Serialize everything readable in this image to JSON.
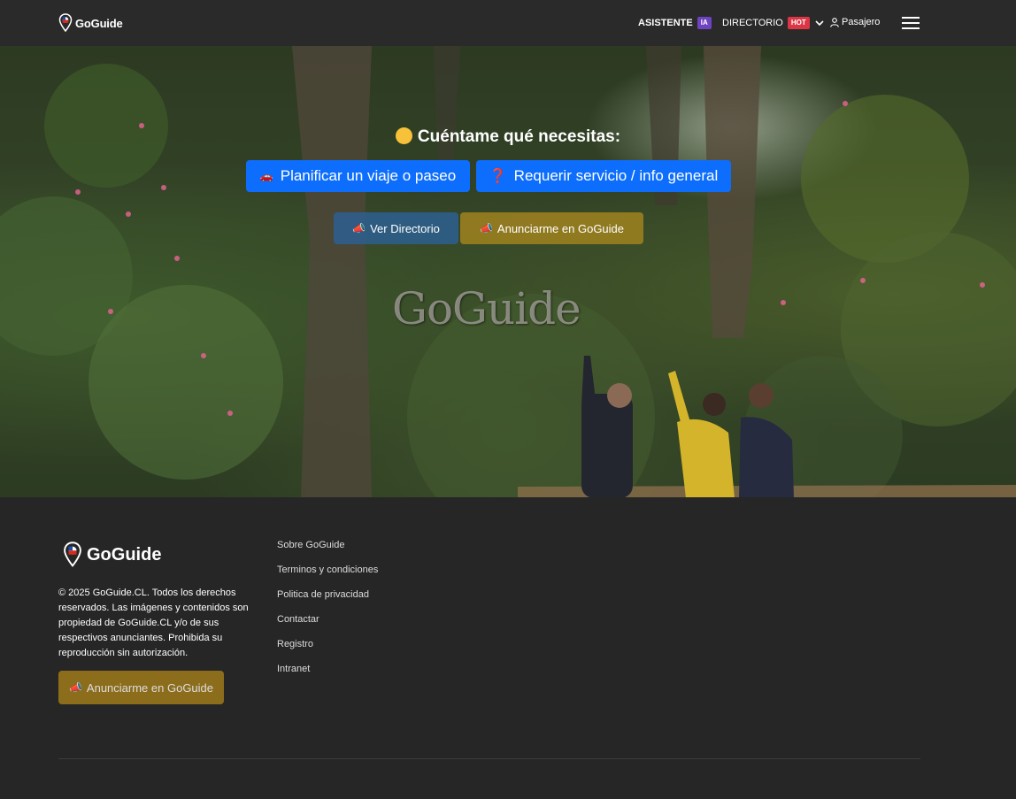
{
  "navbar": {
    "brand": "GoGuide",
    "asistente_label": "ASISTENTE",
    "asistente_badge": "IA",
    "directorio_label": "DIRECTORIO",
    "directorio_badge": "HOT",
    "pasajero_label": "Pasajero",
    "icons": [
      "map-pin-icon",
      "chevron-down-icon",
      "user-icon",
      "hamburger-menu-icon"
    ]
  },
  "hero": {
    "title": "Cuéntame qué necesitas:",
    "plan_button": "Planificar un viaje o paseo",
    "request_button": "Requerir servicio / info general",
    "directory_button": "Ver Directorio",
    "advertise_button": "Anunciarme en GoGuide",
    "watermark": "GoGuide",
    "colors": {
      "primary": "#0d6efd",
      "directory": "#2d5f91",
      "advertise": "#a0821e"
    }
  },
  "footer": {
    "brand": "GoGuide",
    "copyright": "© 2025 GoGuide.CL. Todos los derechos reservados. Las imágenes y contenidos son propiedad de GoGuide.CL y/o de sus respectivos anunciantes. Prohibida su reproducción sin autorización.",
    "advertise_button": "Anunciarme en GoGuide",
    "links": [
      "Sobre GoGuide",
      "Terminos y condiciones",
      "Politica de privacidad",
      "Contactar",
      "Registro",
      "Intranet"
    ]
  }
}
